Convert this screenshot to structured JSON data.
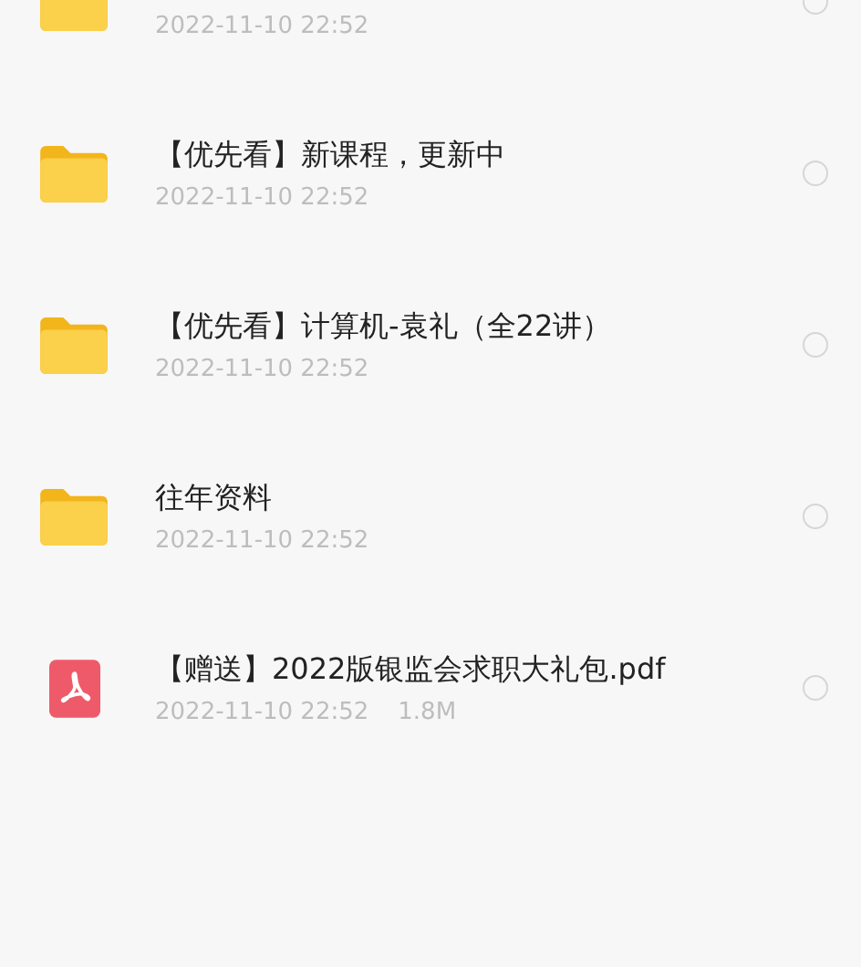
{
  "files": [
    {
      "kind": "folder",
      "date": "2022-11-10 22:52",
      "selected": false
    },
    {
      "kind": "folder",
      "name": "【优先看】新课程，更新中",
      "date": "2022-11-10 22:52",
      "selected": false
    },
    {
      "kind": "folder",
      "name": "【优先看】计算机-袁礼（全22讲）",
      "date": "2022-11-10 22:52",
      "selected": false
    },
    {
      "kind": "folder",
      "name": "往年资料",
      "date": "2022-11-10 22:52",
      "selected": false
    },
    {
      "kind": "pdf",
      "name": "【赠送】2022版银监会求职大礼包.pdf",
      "date": "2022-11-10 22:52",
      "size": "1.8M",
      "selected": false
    }
  ]
}
